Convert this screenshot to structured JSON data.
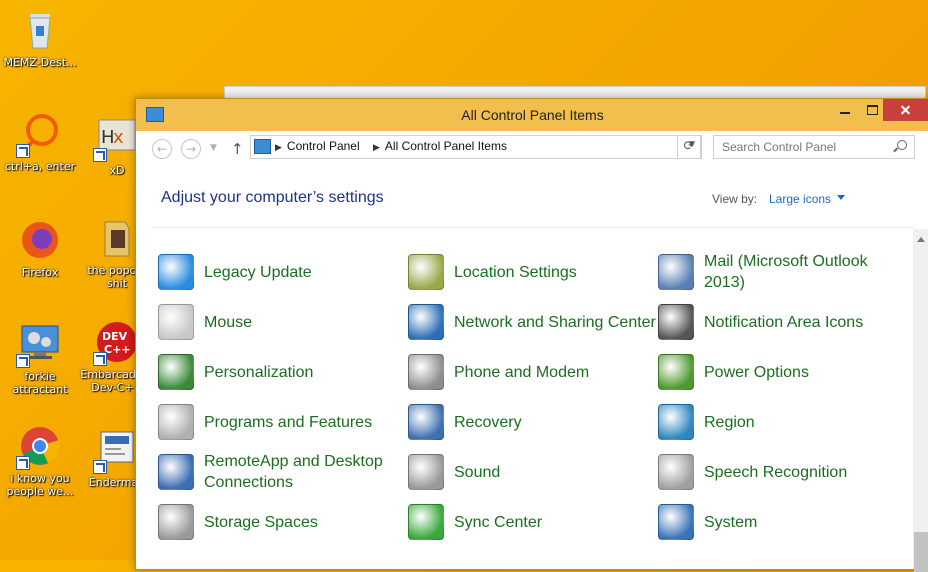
{
  "desktop": {
    "icons": [
      {
        "label": "MEMZ-Dest...",
        "name": "recycle-bin-icon"
      },
      {
        "label": "ctrl+a, enter",
        "name": "search-shortcut-icon"
      },
      {
        "label": "xD",
        "name": "hxd-icon"
      },
      {
        "label": "Firefox",
        "name": "firefox-icon"
      },
      {
        "label": "the popcat shit",
        "name": "folder-icon"
      },
      {
        "label": "forkie attractant",
        "name": "computer-icon"
      },
      {
        "label": "Embarcadero Dev-C++",
        "name": "devcpp-icon"
      },
      {
        "label": "i know you people we...",
        "name": "chrome-icon"
      },
      {
        "label": "Enderman",
        "name": "enderman-icon"
      }
    ]
  },
  "window": {
    "title": "All Control Panel Items",
    "address": {
      "crumbs": [
        "Control Panel",
        "All Control Panel Items"
      ]
    },
    "search_placeholder": "Search Control Panel",
    "heading": "Adjust your computer’s settings",
    "view_by_label": "View by:",
    "view_by_value": "Large icons",
    "items": [
      {
        "label": "Legacy Update",
        "icon": "legacy-update-icon",
        "color": "#2a8be0"
      },
      {
        "label": "Location Settings",
        "icon": "location-settings-icon",
        "color": "#9aa84a"
      },
      {
        "label": "Mail (Microsoft Outlook 2013)",
        "icon": "mail-icon",
        "color": "#5a7fb5"
      },
      {
        "label": "Mouse",
        "icon": "mouse-icon",
        "color": "#c8c8c8"
      },
      {
        "label": "Network and Sharing Center",
        "icon": "network-icon",
        "color": "#2d6fb6"
      },
      {
        "label": "Notification Area Icons",
        "icon": "notification-area-icon",
        "color": "#555555"
      },
      {
        "label": "Personalization",
        "icon": "personalization-icon",
        "color": "#3a8a3a"
      },
      {
        "label": "Phone and Modem",
        "icon": "phone-modem-icon",
        "color": "#8e8e8e"
      },
      {
        "label": "Power Options",
        "icon": "power-options-icon",
        "color": "#4e9a2e"
      },
      {
        "label": "Programs and Features",
        "icon": "programs-features-icon",
        "color": "#b0b0b0"
      },
      {
        "label": "Recovery",
        "icon": "recovery-icon",
        "color": "#3f70b0"
      },
      {
        "label": "Region",
        "icon": "region-icon",
        "color": "#2e86c1"
      },
      {
        "label": "RemoteApp and Desktop Connections",
        "icon": "remoteapp-icon",
        "color": "#3a6db3"
      },
      {
        "label": "Sound",
        "icon": "sound-icon",
        "color": "#999999"
      },
      {
        "label": "Speech Recognition",
        "icon": "speech-recognition-icon",
        "color": "#a0a0a0"
      },
      {
        "label": "Storage Spaces",
        "icon": "storage-spaces-icon",
        "color": "#9a9a9a"
      },
      {
        "label": "Sync Center",
        "icon": "sync-center-icon",
        "color": "#3aa83a"
      },
      {
        "label": "System",
        "icon": "system-icon",
        "color": "#3973b8"
      }
    ]
  }
}
